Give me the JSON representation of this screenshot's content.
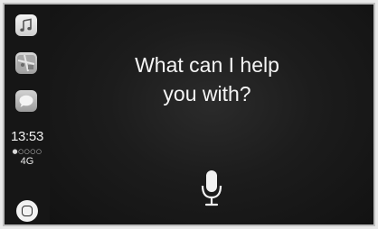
{
  "sidebar": {
    "apps": [
      {
        "name": "Music",
        "icon": "music-icon"
      },
      {
        "name": "Maps",
        "icon": "maps-icon"
      },
      {
        "name": "Messages",
        "icon": "messages-icon"
      }
    ],
    "status": {
      "time": "13:53",
      "signal": "●○○○○",
      "network": "4G"
    },
    "home_icon": "home-icon"
  },
  "siri": {
    "prompt_line1": "What can I help",
    "prompt_line2": "you with?",
    "mic_icon": "microphone-icon"
  },
  "colors": {
    "background": "#121212",
    "text": "#f5f5f5"
  }
}
